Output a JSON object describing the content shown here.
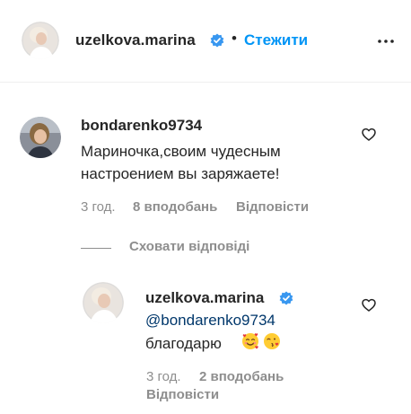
{
  "post_header": {
    "username": "uzelkova.marina",
    "separator": "•",
    "follow_label": "Стежити"
  },
  "comment": {
    "username": "bondarenko9734",
    "text": "Мариночка,своим чудесным настроением вы заряжаете!",
    "time": "3 год.",
    "likes": "8 вподобань",
    "reply_label": "Відповісти"
  },
  "replies_toggle": {
    "label": "Сховати відповіді"
  },
  "reply": {
    "username": "uzelkova.marina",
    "mention": "@bondarenko9734",
    "text": "благодарю",
    "emojis": [
      "smiling-face-with-hearts-icon",
      "face-blowing-kiss-icon"
    ],
    "time": "3 год.",
    "likes": "2 вподобань",
    "reply_label": "Відповісти"
  },
  "colors": {
    "text": "#262626",
    "secondary": "#8e8e8e",
    "link": "#0095f6",
    "mention": "#00376b",
    "verified": "#3897f0"
  }
}
